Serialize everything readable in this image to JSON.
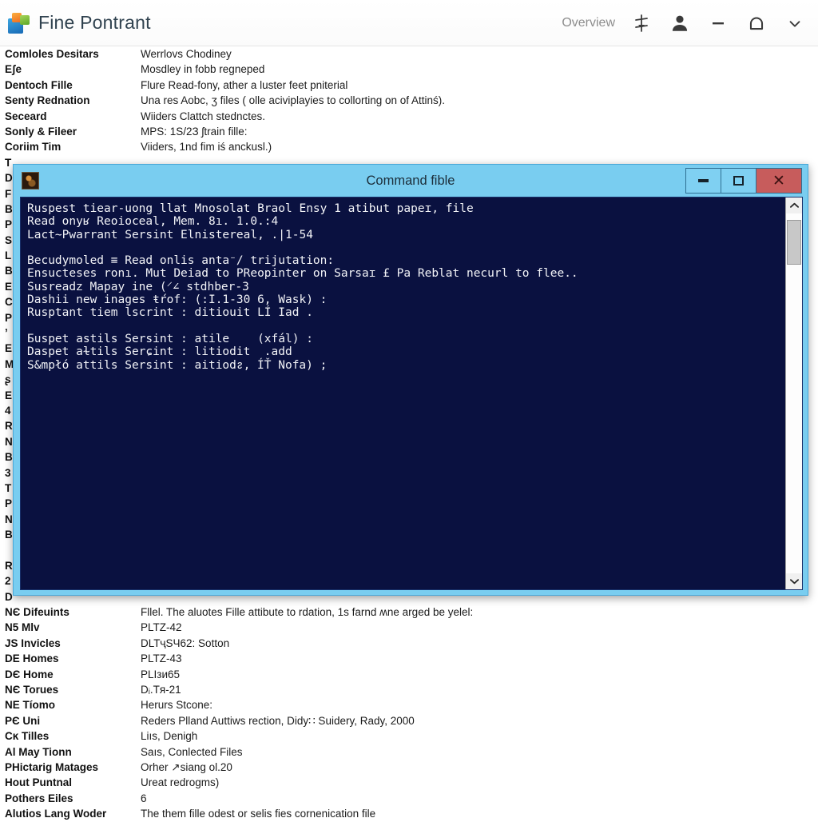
{
  "header": {
    "title": "Fine Pontrant",
    "logo_icon": "picture-gallery-icon",
    "overview_label": "Overview",
    "sort_icon": "sort-vertical-icon",
    "account_icon": "person-icon",
    "minimize_icon": "minimize-dash-icon",
    "bell_icon": "bell-icon",
    "chevron_icon": "chevron-down-icon"
  },
  "rows_top": [
    {
      "label": "Comloles Desitars",
      "desc": "Werrlovs Chodiney"
    },
    {
      "label": "Eʃe",
      "desc": "Mosdley in fobb regneped"
    },
    {
      "label": "Dentoch Fille",
      "desc": "Flure Read-fony, ather a luster feet pniterial"
    },
    {
      "label": "Senty Rednation",
      "desc": "Una res Aobc, ʒ files ( olle aciviplayies to collorting on of Attinś)."
    },
    {
      "label": "Seceard",
      "desc": "Wiiders Clattch stednctes."
    },
    {
      "label": "Sonly & Fileer",
      "desc": "MPS: 1S/2З ʃtrain fille:"
    },
    {
      "label": "Coriim Tim",
      "desc": "Viiders, 1nd fim iś anckusl.)"
    }
  ],
  "rows_hidden": [
    {
      "label": "T",
      "desc": ""
    },
    {
      "label": "D",
      "desc": ""
    },
    {
      "label": "F",
      "desc": ""
    },
    {
      "label": "B",
      "desc": ""
    },
    {
      "label": "P",
      "desc": ""
    },
    {
      "label": "S",
      "desc": ""
    },
    {
      "label": "L",
      "desc": ""
    },
    {
      "label": "B",
      "desc": ""
    },
    {
      "label": "E",
      "desc": ""
    },
    {
      "label": "C",
      "desc": ""
    },
    {
      "label": "P",
      "desc": ""
    },
    {
      "label": "ʼ",
      "desc": ""
    },
    {
      "label": "E",
      "desc": ""
    },
    {
      "label": "M",
      "desc": ""
    },
    {
      "label": "ʂ",
      "desc": ""
    },
    {
      "label": "E",
      "desc": ""
    },
    {
      "label": "4",
      "desc": ""
    },
    {
      "label": "R",
      "desc": ""
    },
    {
      "label": "N",
      "desc": ""
    },
    {
      "label": "B",
      "desc": ""
    },
    {
      "label": "3",
      "desc": ""
    },
    {
      "label": "T",
      "desc": ""
    },
    {
      "label": "P",
      "desc": ""
    },
    {
      "label": "N",
      "desc": ""
    },
    {
      "label": "B",
      "desc": ""
    },
    {
      "label": "",
      "desc": ""
    },
    {
      "label": "R",
      "desc": ""
    },
    {
      "label": "2",
      "desc": ""
    },
    {
      "label": "D",
      "desc": ""
    }
  ],
  "rows_bottom": [
    {
      "label": "NЄ Difeuints",
      "desc": "Fllel. The aluotes Fille attibute to rdation, 1s farnd ʍne arged be yelel:"
    },
    {
      "label": "N5 Mlv",
      "desc": "PLTZ-42"
    },
    {
      "label": "JS Invicles",
      "desc": "DLTҷЅЧ62: Sotton"
    },
    {
      "label": "DE Homes",
      "desc": "PLTZ-43"
    },
    {
      "label": "DЄ Home",
      "desc": "PLІзи65"
    },
    {
      "label": "NЄ Torues",
      "desc": "Dᵢ.Tя-21"
    },
    {
      "label": "NE Tíomo",
      "desc": "Herurs Stcone:"
    },
    {
      "label": "PЄ Uni",
      "desc": "Reders Plland Auttiws rection, Didy∷ Suidery, Rady, 2000"
    },
    {
      "label": "Cĸ Tilles",
      "desc": "Liıs, Denigh"
    },
    {
      "label": "Al May Tionn",
      "desc": "Saıs, Conlected Files"
    },
    {
      "label": "PHictarig Matages",
      "desc": "Orher ↗siang ol.20"
    },
    {
      "label": "Hout Puntnal",
      "desc": "Ureat redrogms)"
    },
    {
      "label": "Pothers Eiles",
      "desc": "6"
    },
    {
      "label": "Alutios Lang Woder",
      "desc": "The them fille odest or selis fies cornenication file"
    }
  ],
  "console": {
    "title": "Command fible",
    "app_icon": "terminal-app-icon",
    "minimize_icon": "minimize-icon",
    "maximize_icon": "maximize-icon",
    "close_icon": "close-icon",
    "scroll_up_icon": "chevron-up-icon",
    "scroll_down_icon": "chevron-down-icon",
    "lines": [
      "Ruspest tiear-uong llat Mnosolat Braol Ensy 1 atibut papeɪ, file",
      "Read onyʁ Reoioceal, Mem. 8ı. 1.0.:4",
      "Lact~Pwarrant Sersint Elnistereal, .|1-54",
      "",
      "Becudymoled ≡ Read onlis anta⁻/ trijutation:",
      "Ensucteses ronı. Mut Deiad to PReopinter on Sarsaɪ £ Pa Reblat necurl to flee..",
      "Susreadᴢ Mapay ine (⸍∠ stdhber-3",
      "Dashii new inages ŧŕof: (:I.1-30 6, Wask) :",
      "Rusptant tiem lscrint : ditiouit LÍ Iad .",
      "",
      "Ƃuspet astils Sersint : atile    (xfál) :",
      "Daspet aɫtils Serɕint : litiodit  .add",
      "S&mpłó attils Sersint : aitiodᴤ, ÍŤ Nofa) ;"
    ]
  }
}
